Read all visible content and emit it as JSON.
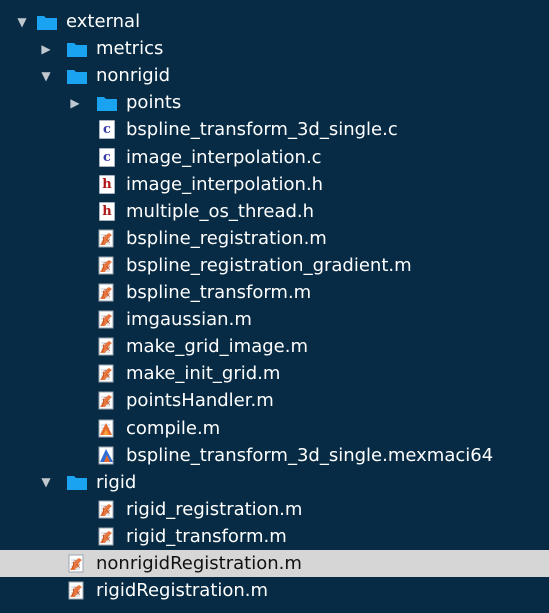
{
  "colors": {
    "background": "#072b44",
    "folder": "#1aa3f0",
    "selected_row": "#d6d6d6",
    "c_file": "#3a3aa8",
    "h_file": "#b01818",
    "matlab_orange": "#e8672a",
    "matlab_blue": "#2f6fd6"
  },
  "tree": {
    "items": [
      {
        "label": "external",
        "type": "folder",
        "depth": 0,
        "expanded": true
      },
      {
        "label": "metrics",
        "type": "folder",
        "depth": 1,
        "expanded": false
      },
      {
        "label": "nonrigid",
        "type": "folder",
        "depth": 1,
        "expanded": true
      },
      {
        "label": "points",
        "type": "folder",
        "depth": 2,
        "expanded": false
      },
      {
        "label": "bspline_transform_3d_single.c",
        "type": "c-file",
        "depth": 2,
        "badge": "c"
      },
      {
        "label": "image_interpolation.c",
        "type": "c-file",
        "depth": 2,
        "badge": "c"
      },
      {
        "label": "image_interpolation.h",
        "type": "h-file",
        "depth": 2,
        "badge": "h"
      },
      {
        "label": "multiple_os_thread.h",
        "type": "h-file",
        "depth": 2,
        "badge": "h"
      },
      {
        "label": "bspline_registration.m",
        "type": "m-function",
        "depth": 2
      },
      {
        "label": "bspline_registration_gradient.m",
        "type": "m-function",
        "depth": 2
      },
      {
        "label": "bspline_transform.m",
        "type": "m-function",
        "depth": 2
      },
      {
        "label": "imgaussian.m",
        "type": "m-function",
        "depth": 2
      },
      {
        "label": "make_grid_image.m",
        "type": "m-function",
        "depth": 2
      },
      {
        "label": "make_init_grid.m",
        "type": "m-function",
        "depth": 2
      },
      {
        "label": "pointsHandler.m",
        "type": "m-function",
        "depth": 2
      },
      {
        "label": "compile.m",
        "type": "m-script",
        "depth": 2
      },
      {
        "label": "bspline_transform_3d_single.mexmaci64",
        "type": "mex-file",
        "depth": 2
      },
      {
        "label": "rigid",
        "type": "folder",
        "depth": 1,
        "expanded": true
      },
      {
        "label": "rigid_registration.m",
        "type": "m-function",
        "depth": 2
      },
      {
        "label": "rigid_transform.m",
        "type": "m-function",
        "depth": 2
      },
      {
        "label": "nonrigidRegistration.m",
        "type": "m-function",
        "depth": 1,
        "selected": true
      },
      {
        "label": "rigidRegistration.m",
        "type": "m-function",
        "depth": 1
      }
    ]
  }
}
